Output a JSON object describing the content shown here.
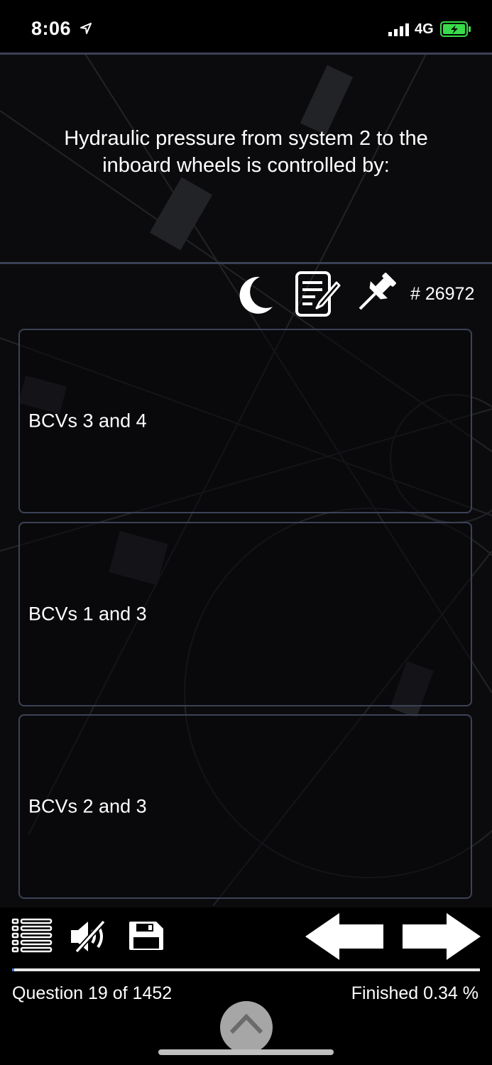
{
  "status_bar": {
    "time": "8:06",
    "network": "4G",
    "battery_color": "#3adb4a"
  },
  "question": {
    "text": "Hydraulic pressure from system 2 to the inboard wheels is controlled by:",
    "id_label": "# 26972"
  },
  "tools": [
    "moon-icon",
    "notes-icon",
    "pin-icon"
  ],
  "answers": [
    {
      "label": "BCVs 3 and 4"
    },
    {
      "label": "BCVs 1 and 3"
    },
    {
      "label": "BCVs 2 and 3"
    }
  ],
  "footer": {
    "counter": "Question 19 of 1452",
    "finished": "Finished 0.34 %",
    "progress_fraction": 0.0034
  },
  "colors": {
    "accent": "#3a4056",
    "background": "#0b0b0d"
  }
}
